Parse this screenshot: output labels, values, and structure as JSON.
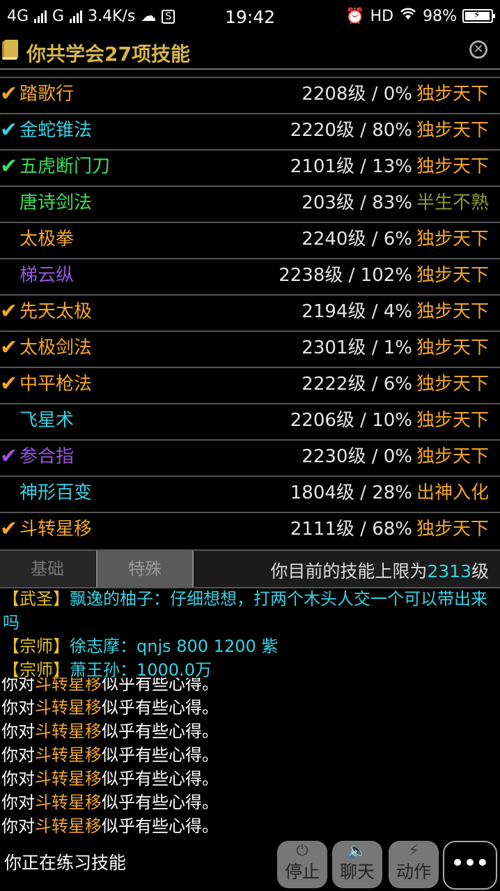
{
  "status_bar": {
    "net1": "4G",
    "net2": "G",
    "speed": "3.4K/s",
    "time": "19:42",
    "hd": "HD",
    "battery": "98%"
  },
  "header": {
    "title": "你共学会27项技能"
  },
  "skills": [
    {
      "check": "✔",
      "check_color": "#f5a623",
      "name": "踏歌行",
      "name_color": "#f5a623",
      "level": "2208级 / 0%",
      "rank": "独步天下",
      "rank_color": "#f5a623"
    },
    {
      "check": "✔",
      "check_color": "#38d2e4",
      "name": "金蛇锥法",
      "name_color": "#38d2e4",
      "level": "2220级 / 80%",
      "rank": "独步天下",
      "rank_color": "#f5a623"
    },
    {
      "check": "✔",
      "check_color": "#3ee05a",
      "name": "五虎断门刀",
      "name_color": "#3ee05a",
      "level": "2101级 / 13%",
      "rank": "独步天下",
      "rank_color": "#f5a623"
    },
    {
      "check": "",
      "check_color": "#3ee05a",
      "name": "唐诗剑法",
      "name_color": "#3ee05a",
      "level": "203级 / 83%",
      "rank": "半生不熟",
      "rank_color": "#8a9a3a"
    },
    {
      "check": "",
      "check_color": "#f5a623",
      "name": "太极拳",
      "name_color": "#f5a623",
      "level": "2240级 / 6%",
      "rank": "独步天下",
      "rank_color": "#f5a623"
    },
    {
      "check": "",
      "check_color": "#9a55e0",
      "name": "梯云纵",
      "name_color": "#9a55e0",
      "level": "2238级 / 102%",
      "rank": "独步天下",
      "rank_color": "#f5a623"
    },
    {
      "check": "✔",
      "check_color": "#f5a623",
      "name": "先天太极",
      "name_color": "#f5a623",
      "level": "2194级 / 4%",
      "rank": "独步天下",
      "rank_color": "#f5a623"
    },
    {
      "check": "✔",
      "check_color": "#f5a623",
      "name": "太极剑法",
      "name_color": "#f5a623",
      "level": "2301级 / 1%",
      "rank": "独步天下",
      "rank_color": "#f5a623"
    },
    {
      "check": "✔",
      "check_color": "#f5a623",
      "name": "中平枪法",
      "name_color": "#f5a623",
      "level": "2222级 / 6%",
      "rank": "独步天下",
      "rank_color": "#f5a623"
    },
    {
      "check": "",
      "check_color": "#38d2e4",
      "name": "飞星术",
      "name_color": "#38d2e4",
      "level": "2206级 / 10%",
      "rank": "独步天下",
      "rank_color": "#f5a623"
    },
    {
      "check": "✔",
      "check_color": "#9a55e0",
      "name": "参合指",
      "name_color": "#9a55e0",
      "level": "2230级 / 0%",
      "rank": "独步天下",
      "rank_color": "#f5a623"
    },
    {
      "check": "",
      "check_color": "#38d2e4",
      "name": "神形百变",
      "name_color": "#38d2e4",
      "level": "1804级 / 28%",
      "rank": "出神入化",
      "rank_color": "#f5a623"
    },
    {
      "check": "✔",
      "check_color": "#f5a623",
      "name": "斗转星移",
      "name_color": "#f5a623",
      "level": "2111级 / 68%",
      "rank": "独步天下",
      "rank_color": "#f5a623"
    }
  ],
  "tabs": {
    "basic": "基础",
    "special": "特殊",
    "limit_prefix": "你目前的技能上限为",
    "limit_value": "2313",
    "limit_suffix": "级"
  },
  "chat": {
    "m1_tag": "【武圣】",
    "m1_text": "飘逸的柚子：仔细想想，打两个木头人交一个可以带出来吗",
    "m2_tag": "【宗师】",
    "m2_text": "徐志摩：qnjs 800 1200 紫",
    "m3_tag": "【宗师】",
    "m3_text": "萧王孙：1000.0万"
  },
  "log": {
    "prefix": "你对",
    "skill": "斗转星移",
    "suffix": "似乎有些心得。",
    "count": 7
  },
  "bottom": {
    "practice": "你正在练习技能",
    "stop": "停止",
    "chat": "聊天",
    "action": "动作",
    "more": "•••"
  }
}
